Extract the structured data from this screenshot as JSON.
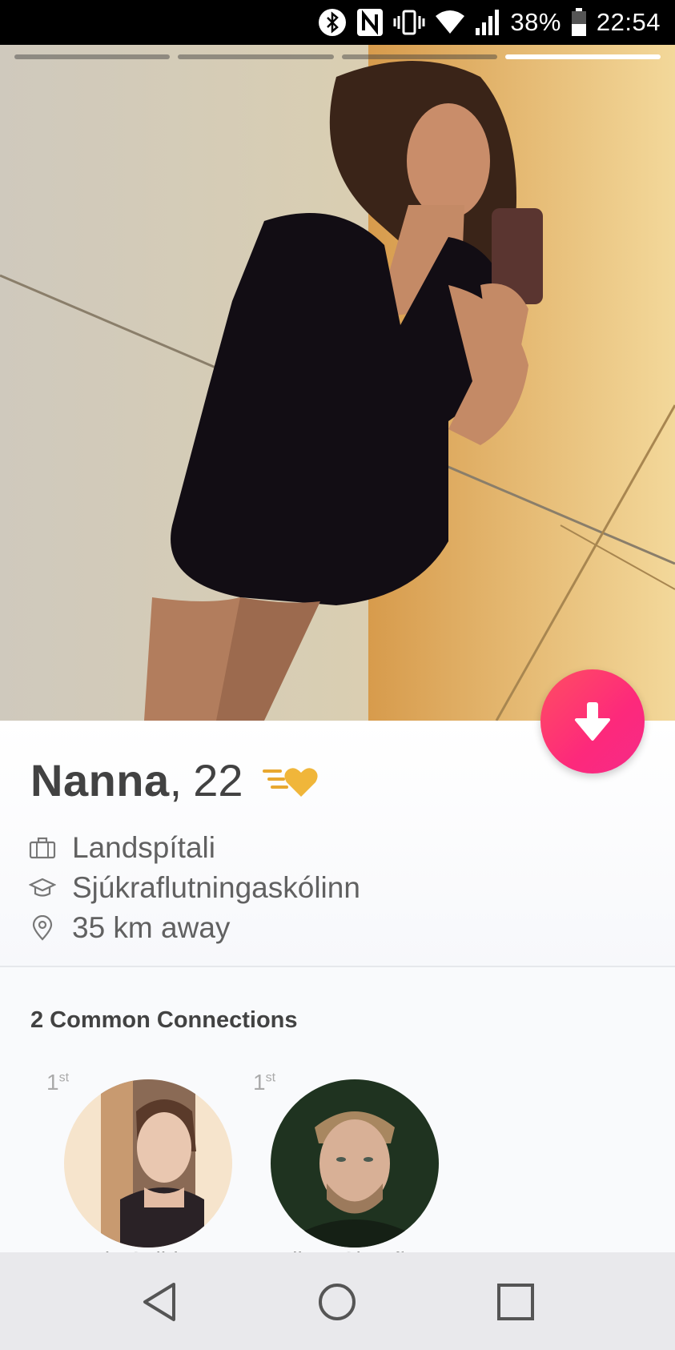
{
  "status_bar": {
    "battery_percent": "38%",
    "time": "22:54",
    "icons": [
      "bluetooth-icon",
      "nfc-icon",
      "vibrate-icon",
      "wifi-icon",
      "signal-icon",
      "battery-icon"
    ]
  },
  "photo": {
    "progress_segments": 4,
    "active_segment": 4
  },
  "profile": {
    "name": "Nanna",
    "separator": ",",
    "age": "22",
    "job": "Landspítali",
    "school": "Sjúkraflutningaskólinn",
    "distance": "35 km away"
  },
  "connections": {
    "title": "2 Common Connections",
    "items": [
      {
        "degree": "1",
        "degree_suffix": "st",
        "name": "Erla Solbjorg"
      },
      {
        "degree": "1",
        "degree_suffix": "st",
        "name": "Viktor Sigurðss"
      }
    ]
  },
  "colors": {
    "accent": "#fd297b",
    "superlike": "#e8a830"
  },
  "nav": [
    "back-icon",
    "home-icon",
    "recents-icon"
  ]
}
